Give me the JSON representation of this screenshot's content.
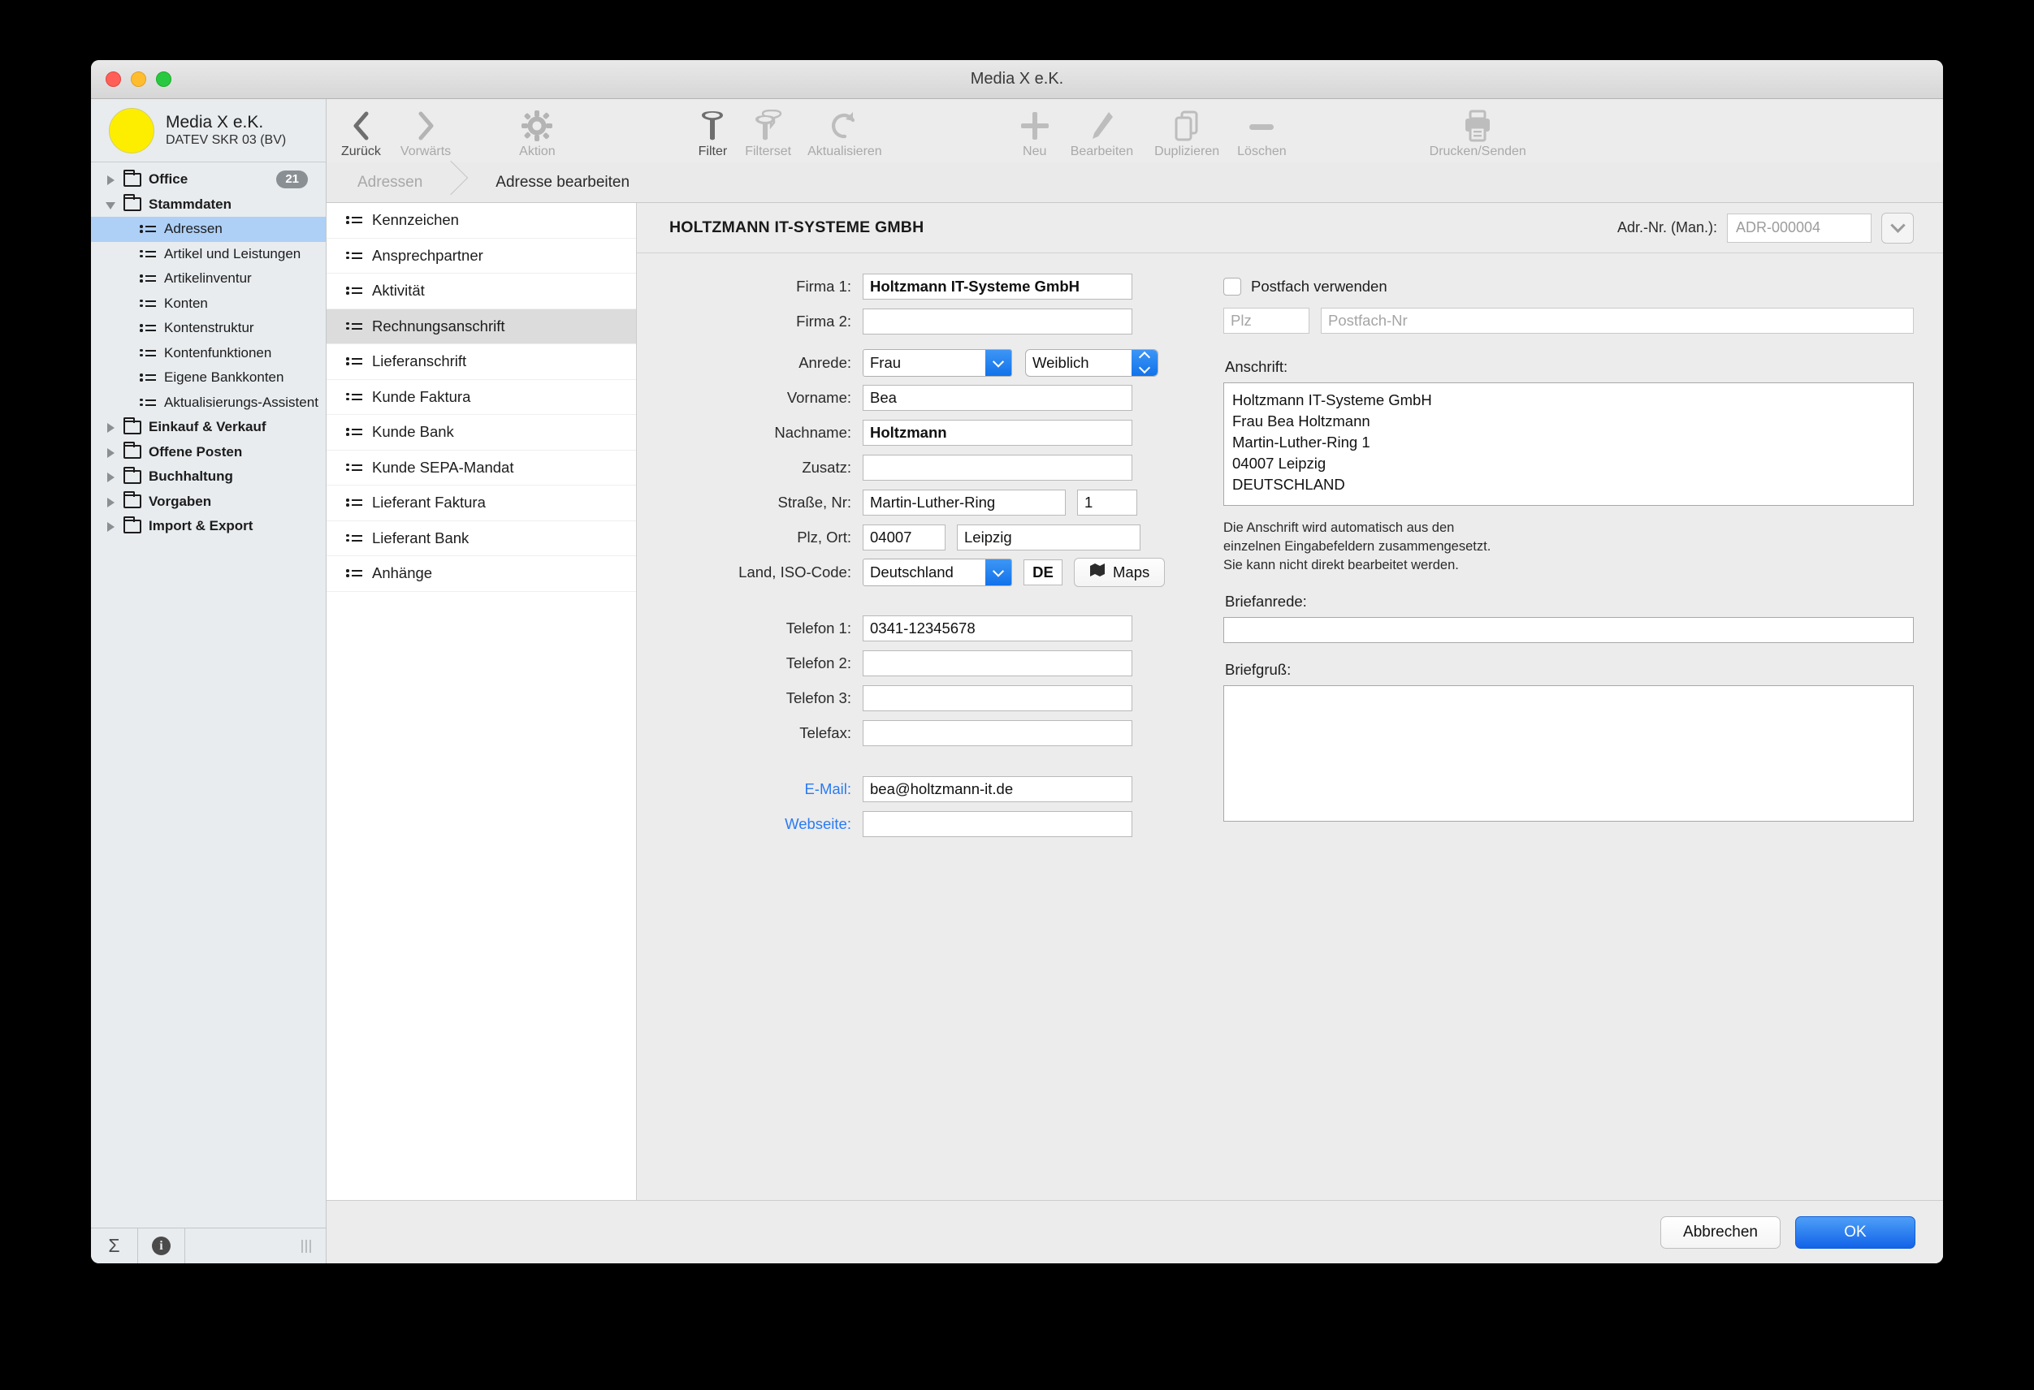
{
  "window": {
    "title": "Media X e.K."
  },
  "sidebar": {
    "company": "Media X e.K.",
    "chart_of_accounts": "DATEV SKR 03 (BV)",
    "items": [
      {
        "label": "Office",
        "type": "group",
        "expanded": false,
        "badge": "21"
      },
      {
        "label": "Stammdaten",
        "type": "group",
        "expanded": true,
        "badge": ""
      },
      {
        "label": "Adressen",
        "type": "leaf",
        "selected": true
      },
      {
        "label": "Artikel und Leistungen",
        "type": "leaf",
        "selected": false
      },
      {
        "label": "Artikelinventur",
        "type": "leaf",
        "selected": false
      },
      {
        "label": "Konten",
        "type": "leaf",
        "selected": false
      },
      {
        "label": "Kontenstruktur",
        "type": "leaf",
        "selected": false
      },
      {
        "label": "Kontenfunktionen",
        "type": "leaf",
        "selected": false
      },
      {
        "label": "Eigene Bankkonten",
        "type": "leaf",
        "selected": false
      },
      {
        "label": "Aktualisierungs-Assistent",
        "type": "leaf",
        "selected": false
      },
      {
        "label": "Einkauf & Verkauf",
        "type": "group",
        "expanded": false,
        "badge": ""
      },
      {
        "label": "Offene Posten",
        "type": "group",
        "expanded": false,
        "badge": ""
      },
      {
        "label": "Buchhaltung",
        "type": "group",
        "expanded": false,
        "badge": ""
      },
      {
        "label": "Vorgaben",
        "type": "group",
        "expanded": false,
        "badge": ""
      },
      {
        "label": "Import & Export",
        "type": "group",
        "expanded": false,
        "badge": ""
      }
    ],
    "footer": {
      "sum_symbol": "Σ",
      "info_symbol": "i"
    }
  },
  "toolbar": {
    "items": [
      {
        "label": "Zurück",
        "icon": "chevron-left-icon",
        "enabled": true
      },
      {
        "label": "Vorwärts",
        "icon": "chevron-right-icon",
        "enabled": false
      },
      {
        "label": "Aktion",
        "icon": "gear-icon",
        "enabled": false
      },
      {
        "label": "Filter",
        "icon": "funnel-icon",
        "enabled": true
      },
      {
        "label": "Filterset",
        "icon": "funnel-set-icon",
        "enabled": false
      },
      {
        "label": "Aktualisieren",
        "icon": "refresh-icon",
        "enabled": false
      },
      {
        "label": "Neu",
        "icon": "plus-icon",
        "enabled": false
      },
      {
        "label": "Bearbeiten",
        "icon": "pencil-icon",
        "enabled": false
      },
      {
        "label": "Duplizieren",
        "icon": "duplicate-icon",
        "enabled": false
      },
      {
        "label": "Löschen",
        "icon": "minus-icon",
        "enabled": false
      },
      {
        "label": "Drucken/Senden",
        "icon": "printer-icon",
        "enabled": false
      }
    ]
  },
  "breadcrumb": {
    "parent": "Adressen",
    "current": "Adresse bearbeiten"
  },
  "tabs": [
    {
      "label": "Kennzeichen",
      "selected": false
    },
    {
      "label": "Ansprechpartner",
      "selected": false
    },
    {
      "label": "Aktivität",
      "selected": false
    },
    {
      "label": "Rechnungsanschrift",
      "selected": true
    },
    {
      "label": "Lieferanschrift",
      "selected": false
    },
    {
      "label": "Kunde Faktura",
      "selected": false
    },
    {
      "label": "Kunde Bank",
      "selected": false
    },
    {
      "label": "Kunde SEPA-Mandat",
      "selected": false
    },
    {
      "label": "Lieferant Faktura",
      "selected": false
    },
    {
      "label": "Lieferant Bank",
      "selected": false
    },
    {
      "label": "Anhänge",
      "selected": false
    }
  ],
  "form": {
    "title": "HOLTZMANN IT-SYSTEME GMBH",
    "adrnr_label": "Adr.-Nr. (Man.):",
    "adrnr_value": "ADR-000004",
    "labels": {
      "firma1": "Firma 1:",
      "firma2": "Firma 2:",
      "anrede": "Anrede:",
      "vorname": "Vorname:",
      "nachname": "Nachname:",
      "zusatz": "Zusatz:",
      "strasse": "Straße, Nr:",
      "plzort": "Plz, Ort:",
      "land": "Land, ISO-Code:",
      "telefon1": "Telefon 1:",
      "telefon2": "Telefon 2:",
      "telefon3": "Telefon 3:",
      "telefax": "Telefax:",
      "email": "E-Mail:",
      "webseite": "Webseite:"
    },
    "values": {
      "firma1": "Holtzmann IT-Systeme GmbH",
      "firma2": "",
      "anrede": "Frau",
      "geschlecht": "Weiblich",
      "vorname": "Bea",
      "nachname": "Holtzmann",
      "zusatz": "",
      "strasse": "Martin-Luther-Ring",
      "hausnr": "1",
      "plz": "04007",
      "ort": "Leipzig",
      "land": "Deutschland",
      "iso": "DE",
      "maps_button": "Maps",
      "telefon1": "0341-12345678",
      "telefon2": "",
      "telefon3": "",
      "telefax": "",
      "email": "bea@holtzmann-it.de",
      "webseite": ""
    },
    "right": {
      "postfach_checkbox": "Postfach verwenden",
      "postfach_plz_placeholder": "Plz",
      "postfach_nr_placeholder": "Postfach-Nr",
      "anschrift_label": "Anschrift:",
      "anschrift_value": "Holtzmann IT-Systeme GmbH\nFrau Bea Holtzmann\nMartin-Luther-Ring 1\n04007 Leipzig\nDEUTSCHLAND",
      "anschrift_note": "Die Anschrift wird automatisch aus den einzelnen Eingabefeldern zusammengesetzt. Sie kann nicht direkt bearbeitet werden.",
      "briefanrede_label": "Briefanrede:",
      "briefanrede_value": "",
      "briefgruss_label": "Briefgruß:",
      "briefgruss_value": ""
    }
  },
  "buttons": {
    "cancel": "Abbrechen",
    "ok": "OK"
  },
  "colors": {
    "accent_blue": "#1272ea",
    "selection_blue": "#aed0f7",
    "link_blue": "#2a7bf2",
    "logo_yellow": "#fdee00",
    "badge_gray": "#8a8f94"
  }
}
